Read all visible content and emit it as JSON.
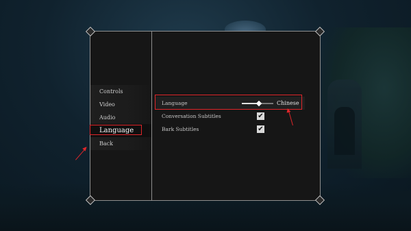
{
  "menu": {
    "items": [
      {
        "label": "Controls"
      },
      {
        "label": "Video"
      },
      {
        "label": "Audio"
      },
      {
        "label": "Language"
      },
      {
        "label": "Back"
      }
    ],
    "selected": "Language"
  },
  "settings": {
    "language": {
      "label": "Language",
      "value": "Chinese",
      "slider_level": 0.55
    },
    "conversation_subtitles": {
      "label": "Conversation Subtitles",
      "checked": true
    },
    "bark_subtitles": {
      "label": "Bark Subtitles",
      "checked": true
    }
  },
  "icons": {
    "checkmark": "checkmark-icon",
    "slider_knob": "diamond-knob-icon"
  },
  "colors": {
    "annotation": "#e0262a",
    "panel": "#161616",
    "border": "#8e8e8e"
  }
}
